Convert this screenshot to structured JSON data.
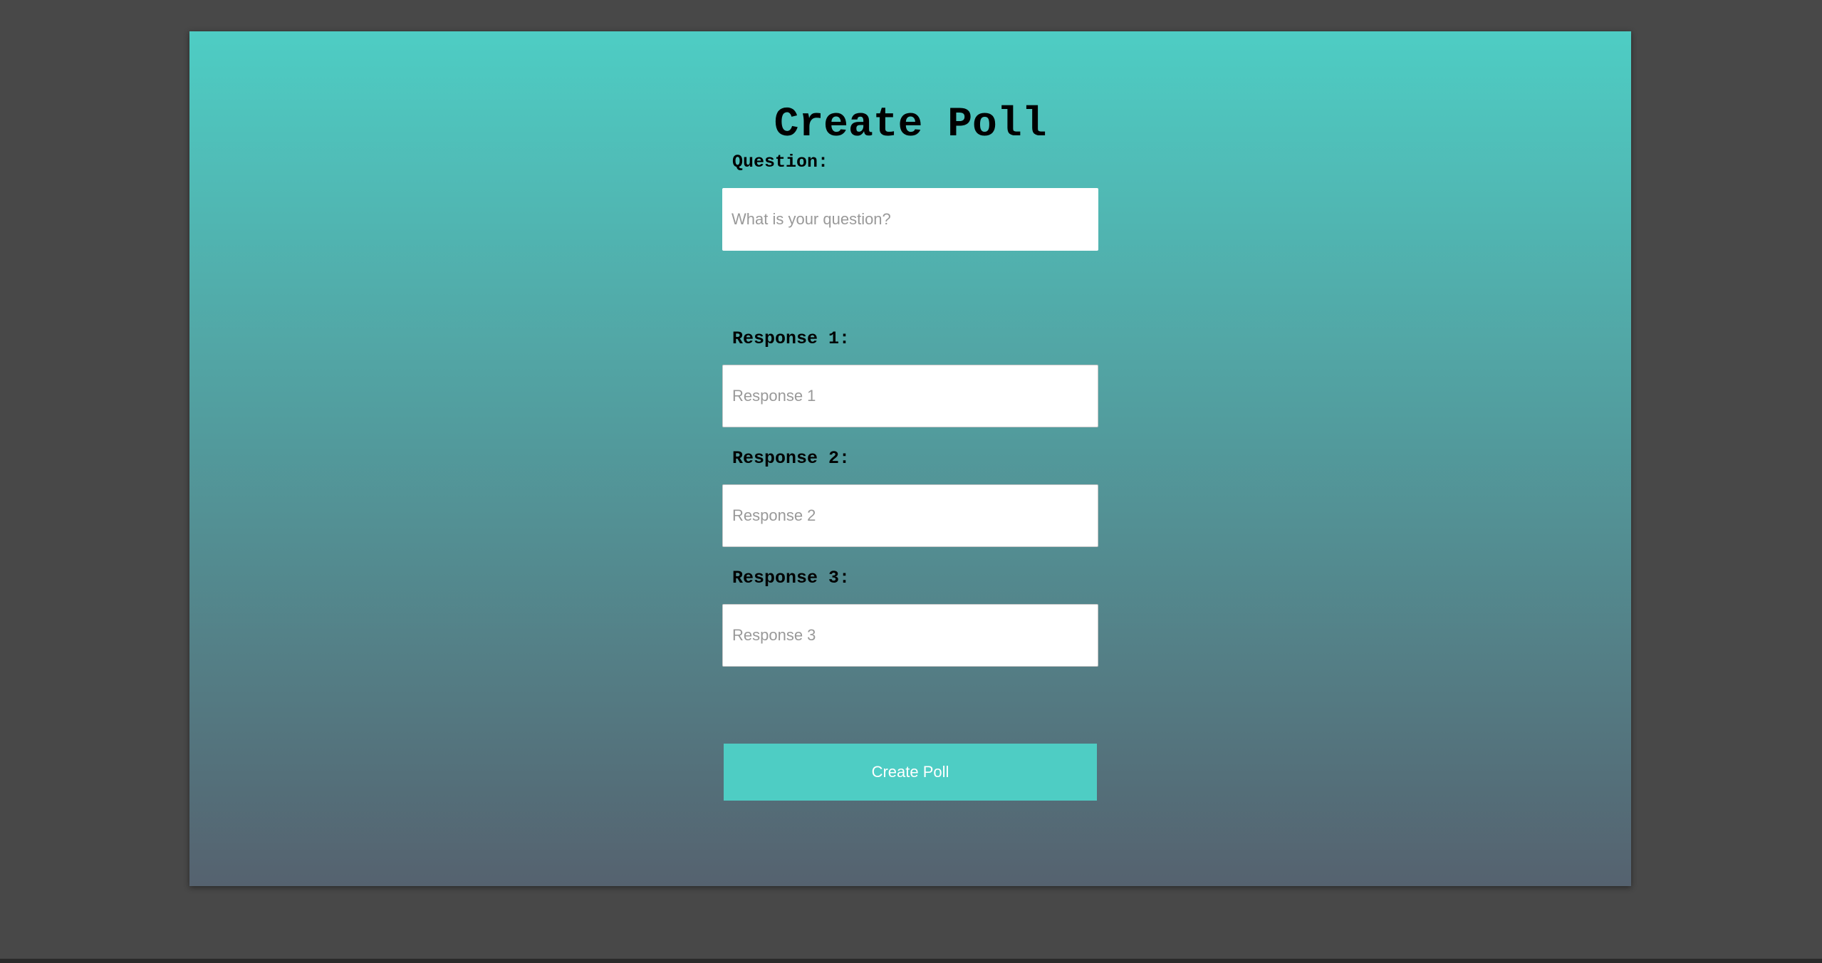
{
  "form": {
    "title": "Create Poll",
    "question": {
      "label": "Question:",
      "placeholder": "What is your question?",
      "value": ""
    },
    "responses": [
      {
        "label": "Response 1:",
        "placeholder": "Response 1",
        "value": ""
      },
      {
        "label": "Response 2:",
        "placeholder": "Response 2",
        "value": ""
      },
      {
        "label": "Response 3:",
        "placeholder": "Response 3",
        "value": ""
      }
    ],
    "submit_label": "Create Poll"
  },
  "colors": {
    "accent": "#4ecdc4",
    "gradient_top": "#4ecdc4",
    "gradient_bottom": "#55626f",
    "backdrop": "#484848"
  }
}
